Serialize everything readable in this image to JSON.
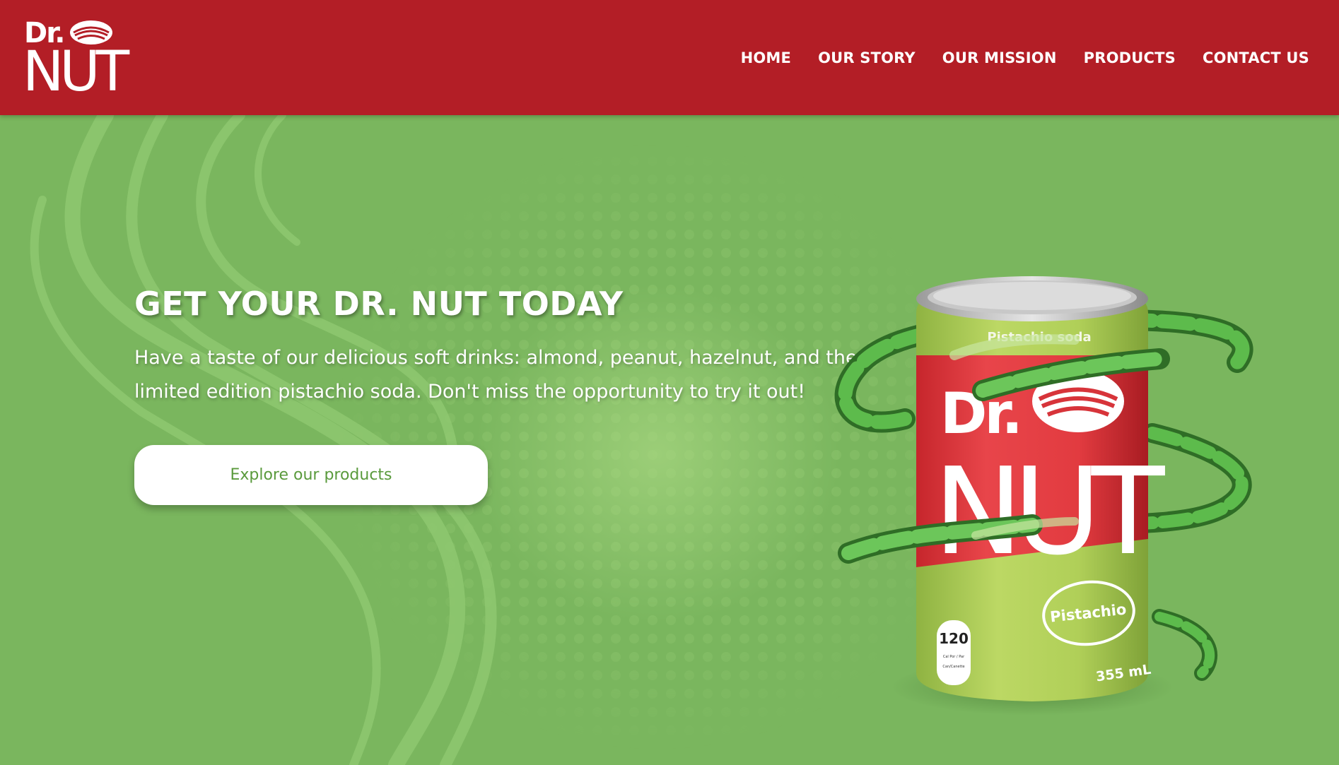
{
  "brand": {
    "logo_top": "Dr.",
    "logo_bottom": "NUT",
    "primary_color": "#b31e26",
    "secondary_color": "#7ab65e"
  },
  "nav": {
    "items": [
      {
        "label": "HOME"
      },
      {
        "label": "OUR STORY"
      },
      {
        "label": "OUR MISSION"
      },
      {
        "label": "PRODUCTS"
      },
      {
        "label": "CONTACT US"
      }
    ]
  },
  "hero": {
    "title": "GET YOUR DR. NUT TODAY",
    "subtitle": "Have a taste of our delicious soft drinks: almond, peanut, hazelnut, and the limited edition pistachio soda. Don't miss the opportunity to try it out!",
    "cta_label": "Explore our products"
  },
  "can": {
    "top_band": "Pistachio soda",
    "brand_top": "Dr.",
    "brand_bottom": "NUT",
    "flavor": "Pistachio",
    "calories": "120",
    "calorie_note_1": "Cal Por / Par",
    "calorie_note_2": "Can/Canette",
    "volume": "355 mL"
  }
}
